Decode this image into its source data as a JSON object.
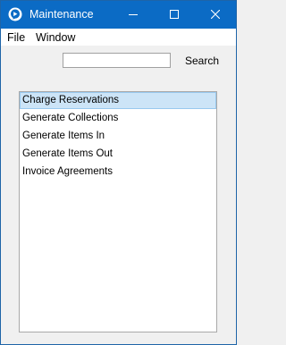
{
  "window": {
    "title": "Maintenance",
    "icon": "app-logo-icon",
    "controls": [
      "minimize-icon",
      "maximize-icon",
      "close-icon"
    ]
  },
  "menu": {
    "file": "File",
    "window": "Window"
  },
  "search": {
    "value": "",
    "placeholder": "",
    "button_label": "Search"
  },
  "list": {
    "items": [
      {
        "label": "Charge Reservations",
        "selected": true
      },
      {
        "label": "Generate Collections",
        "selected": false
      },
      {
        "label": "Generate Items In",
        "selected": false
      },
      {
        "label": "Generate Items Out",
        "selected": false
      },
      {
        "label": "Invoice Agreements",
        "selected": false
      }
    ]
  },
  "colors": {
    "titlebar": "#0b6bc5",
    "selection": "#cce4f7",
    "selection_border": "#99c9ef"
  }
}
